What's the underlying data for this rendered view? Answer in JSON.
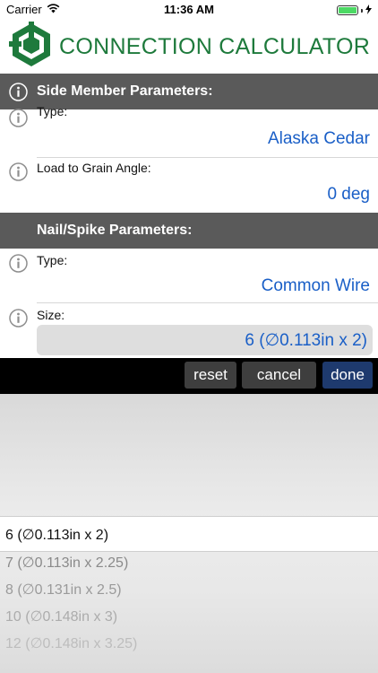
{
  "status_bar": {
    "carrier": "Carrier",
    "time": "11:36 AM",
    "battery_level": 1.0
  },
  "header": {
    "title": "CONNECTION CALCULATOR",
    "brand_color": "#1e7a3c"
  },
  "side_member": {
    "header": "Side Member Parameters:",
    "type_label": "Type:",
    "type_value": "Alaska Cedar",
    "angle_label": "Load to Grain Angle:",
    "angle_value": "0 deg"
  },
  "nail": {
    "header": "Nail/Spike Parameters:",
    "type_label": "Type:",
    "type_value": "Common Wire",
    "size_label": "Size:",
    "size_value": "6 (∅0.113in x 2)"
  },
  "toolbar": {
    "reset": "reset",
    "cancel": "cancel",
    "done": "done"
  },
  "picker": {
    "options": [
      "6 (∅0.113in x 2)",
      "7 (∅0.113in x 2.25)",
      "8 (∅0.131in x 2.5)",
      "10 (∅0.148in x 3)",
      "12 (∅0.148in x 3.25)"
    ],
    "selected_index": 0
  },
  "colors": {
    "value_blue": "#1a5fc7",
    "section_gray": "#5a5a5a",
    "done_blue": "#1e3a6e"
  },
  "icons": [
    "wifi-icon",
    "charging-icon",
    "battery-icon",
    "logo-icon",
    "info-icon"
  ]
}
